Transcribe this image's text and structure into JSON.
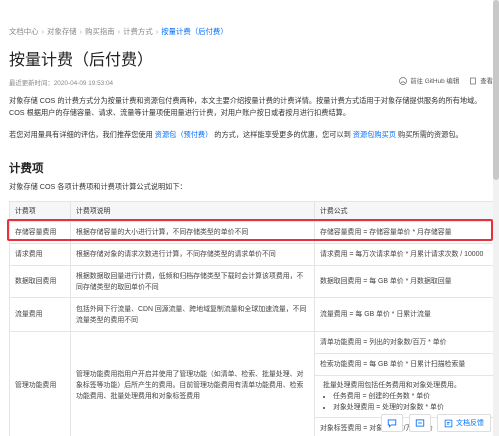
{
  "breadcrumb": [
    "文档中心",
    "对象存储",
    "购买指南",
    "计费方式",
    "按量计费（后付费）"
  ],
  "breadcrumb_sep": "›",
  "page_title": "按量计费（后付费）",
  "updated": "最近更新时间：2020-04-09 19:53:04",
  "actions": {
    "github": "前往 GitHub 编辑",
    "view": "查看"
  },
  "intro": {
    "line1": "对象存储 COS 的计费方式分为按量计费和资源包付费两种，本文主要介绍按量计费的计费详情。按量计费方式适用于对象存储提供服务的所有地域。COS 根据用户的存储容量、请求、流量等计量项使用量进行计费，对用户账户按日或者按月进行扣费结算。",
    "line2_pre": "若您对用量具有详细的评估，我们推荐您使用",
    "line2_link1": "资源包（预付费）",
    "line2_mid": "的方式，这样能享受更多的优惠，您可以到",
    "line2_link2": "资源包购买页",
    "line2_post": "购买所需的资源包。"
  },
  "section_title": "计费项",
  "section_desc": "对象存储 COS 各项计费项和计费项计算公式说明如下：",
  "table": {
    "headers": [
      "计费项",
      "计费项说明",
      "计费公式"
    ],
    "rows": [
      {
        "item": "存储容量费用",
        "desc": "根据存储容量的大小进行计算，不同存储类型的单价不同",
        "formula": "存储容量费用 = 存储容量单价 * 月存储容量"
      },
      {
        "item": "请求费用",
        "desc": "根据存储对象的请求次数进行计算，不同存储类型的请求单价不同",
        "formula": "请求费用 = 每万次请求单价 * 月累计请求次数 / 10000"
      },
      {
        "item": "数据取回费用",
        "desc": "根据数据取回量进行计费，低频和归档存储类型下载时会计算该项费用，不同存储类型的取回单价不同",
        "formula": "数据取回费用 = 每 GB 单价 * 月数据取回量"
      },
      {
        "item": "流量费用",
        "desc": "包括外网下行流量、CDN 回源流量、跨地域复制流量和全球加速流量，不同流量类型的费用不同",
        "formula": "流量费用 = 每 GB 单价 * 日累计流量"
      }
    ],
    "mgmt": {
      "item": "管理功能费用",
      "desc": "管理功能费用指用户开启并使用了管理功能（如清单、检索、批量处理、对象标签等功能）后所产生的费用。目前管理功能费用有清单功能费用、检索功能费用、批量处理费用和对象标签费用",
      "formulas": [
        "清单功能费用 = 列出的对象数/百万 * 单价",
        "检索功能费用 = 每 GB 单价 * 日累计扫描检索量"
      ],
      "batch_intro": "批量处理费用包括任务费用和对象处理费用。",
      "batch_items": [
        "任务费用 = 创建的任务数 * 单价",
        "对象处理费用 = 处理的对象数 * 单价"
      ],
      "tag_formula": "对象标签费用 = 对象标签数/万 * 单价"
    }
  },
  "float": {
    "feedback": "文档反馈"
  }
}
